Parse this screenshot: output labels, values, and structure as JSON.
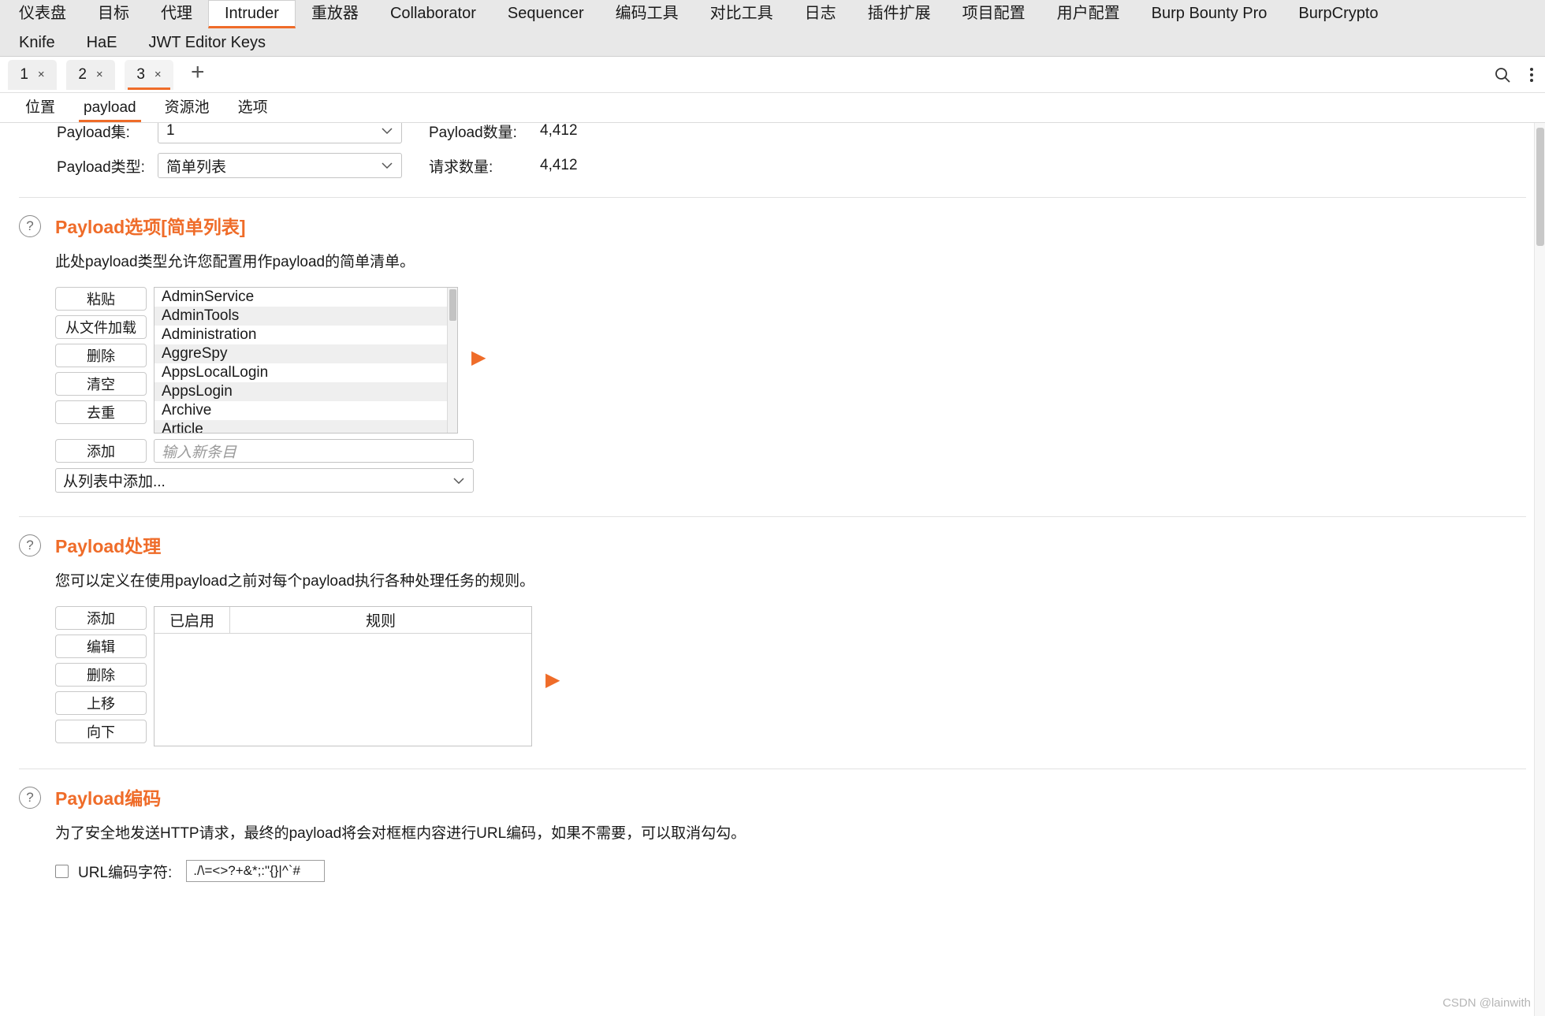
{
  "topnav": {
    "row1": [
      {
        "label": "仪表盘",
        "active": false
      },
      {
        "label": "目标",
        "active": false
      },
      {
        "label": "代理",
        "active": false
      },
      {
        "label": "Intruder",
        "active": true
      },
      {
        "label": "重放器",
        "active": false
      },
      {
        "label": "Collaborator",
        "active": false
      },
      {
        "label": "Sequencer",
        "active": false
      },
      {
        "label": "编码工具",
        "active": false
      },
      {
        "label": "对比工具",
        "active": false
      },
      {
        "label": "日志",
        "active": false
      },
      {
        "label": "插件扩展",
        "active": false
      },
      {
        "label": "项目配置",
        "active": false
      },
      {
        "label": "用户配置",
        "active": false
      },
      {
        "label": "Burp Bounty Pro",
        "active": false
      },
      {
        "label": "BurpCrypto",
        "active": false
      }
    ],
    "row2": [
      {
        "label": "Knife"
      },
      {
        "label": "HaE"
      },
      {
        "label": "JWT Editor Keys"
      }
    ]
  },
  "tabstrip": {
    "tabs": [
      {
        "label": "1",
        "close": "×",
        "active": false
      },
      {
        "label": "2",
        "close": "×",
        "active": false
      },
      {
        "label": "3",
        "close": "×",
        "active": true
      }
    ],
    "add_label": "+",
    "search_icon": "search-icon",
    "menu_icon": "kebab-menu-icon"
  },
  "subtabs": [
    {
      "label": "位置",
      "active": false
    },
    {
      "label": "payload",
      "active": true
    },
    {
      "label": "资源池",
      "active": false
    },
    {
      "label": "选项",
      "active": false
    }
  ],
  "payload_set": {
    "set_label": "Payload集:",
    "set_value": "1",
    "type_label": "Payload类型:",
    "type_value": "简单列表",
    "count_label": "Payload数量:",
    "count_value": "4,412",
    "request_label": "请求数量:",
    "request_value": "4,412"
  },
  "payload_options": {
    "title": "Payload选项[简单列表]",
    "description": "此处payload类型允许您配置用作payload的简单清单。",
    "buttons": [
      "粘贴",
      "从文件加载",
      "删除",
      "清空",
      "去重"
    ],
    "add_button": "添加",
    "add_placeholder": "输入新条目",
    "add_from_list": "从列表中添加...",
    "items": [
      "AdminService",
      "AdminTools",
      "Administration",
      "AggreSpy",
      "AppsLocalLogin",
      "AppsLogin",
      "Archive",
      "Article"
    ]
  },
  "payload_processing": {
    "title": "Payload处理",
    "description": "您可以定义在使用payload之前对每个payload执行各种处理任务的规则。",
    "buttons": [
      "添加",
      "编辑",
      "删除",
      "上移",
      "向下"
    ],
    "columns": [
      "已启用",
      "规则"
    ],
    "rows": []
  },
  "payload_encoding": {
    "title": "Payload编码",
    "description": "为了安全地发送HTTP请求，最终的payload将会对框框内容进行URL编码，如果不需要，可以取消勾勾。",
    "checkbox_checked": false,
    "checkbox_label": "URL编码字符:",
    "chars_value": "./\\=<>?+&*;:\"{}|^`#"
  },
  "colors": {
    "accent": "#ef6c29",
    "nav_bg": "#e8e8e8",
    "row_alt": "#efefef"
  },
  "watermark": "CSDN @lainwith"
}
